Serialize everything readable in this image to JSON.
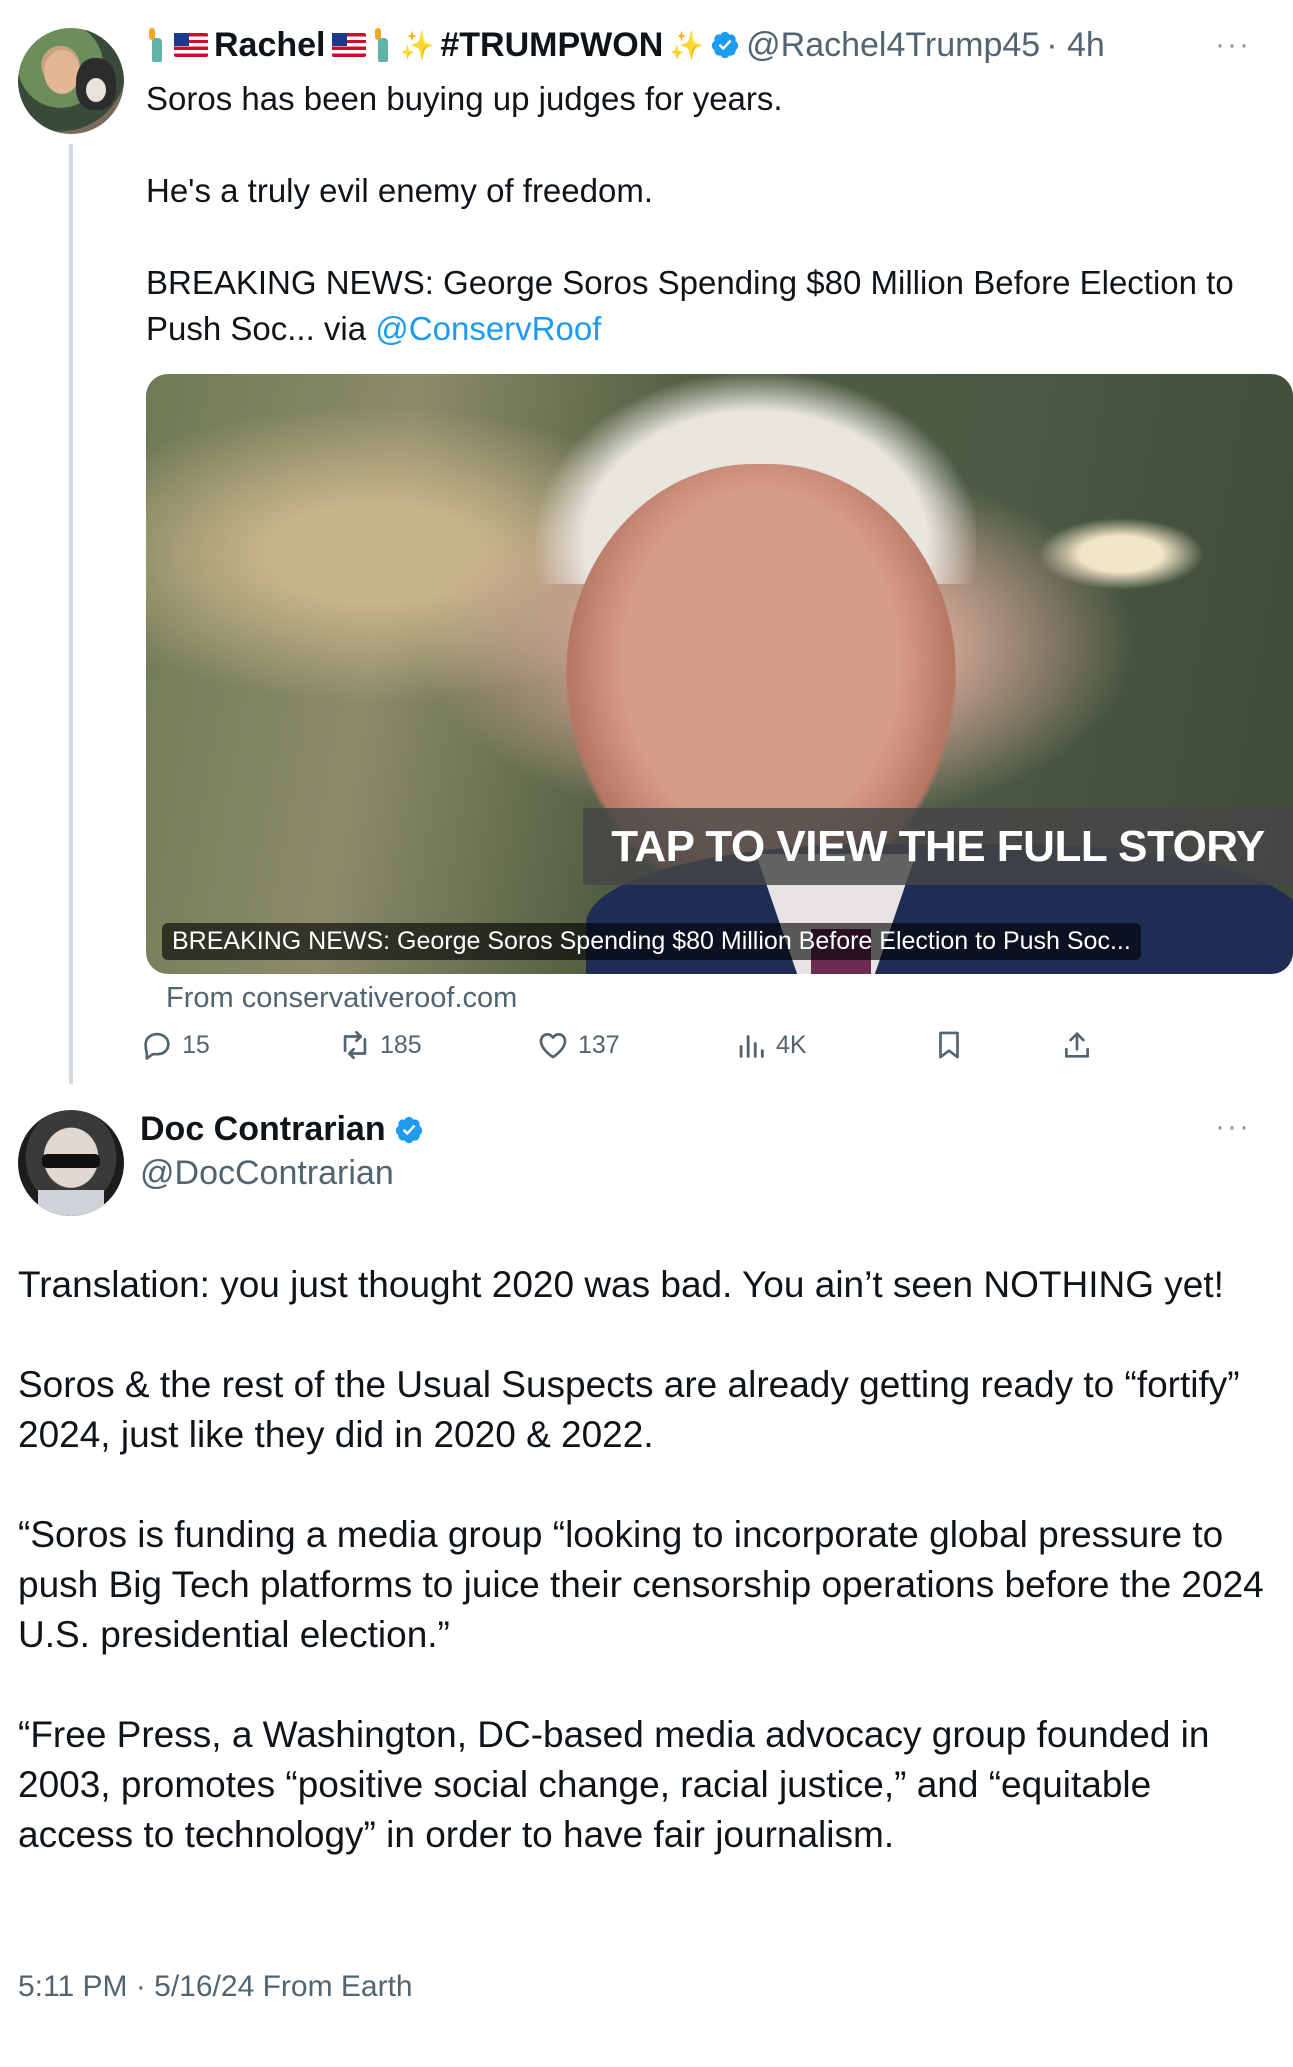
{
  "tweet1": {
    "display_name": "Rachel",
    "hashtag": "#TRUMPWON",
    "handle": "@Rachel4Trump45",
    "time": "· 4h",
    "more": "···",
    "text": {
      "line1": "Soros has been buying up judges for years.",
      "line2": "He's a truly evil enemy of freedom.",
      "line3": " BREAKING NEWS: George Soros Spending $80 Million Before Election to Push Soc... via ",
      "mention": "@ConservRoof"
    },
    "card": {
      "banner": "TAP TO VIEW THE FULL STORY",
      "caption": "BREAKING NEWS: George Soros Spending $80 Million Before Election to Push Soc...",
      "source": "From conservativeroof.com"
    },
    "actions": {
      "replies": "15",
      "reposts": "185",
      "likes": "137",
      "views": "4K"
    }
  },
  "tweet2": {
    "display_name": "Doc Contrarian",
    "handle": "@DocContrarian",
    "more": "···",
    "paragraphs": [
      "Translation:  you just thought 2020 was bad. You ain’t seen NOTHING yet!",
      "Soros & the rest of the Usual Suspects are already getting ready to “fortify” 2024, just like they did in 2020 & 2022.",
      "“Soros is funding a media group “looking to incorporate global pressure to push Big Tech platforms to juice their censorship operations before the 2024 U.S. presidential election.”",
      "“Free Press, a Washington, DC-based media advocacy group founded in 2003, promotes “positive social change, racial justice,” and “equitable access to technology” in order to have fair journalism."
    ],
    "timestamp": "5:11 PM · 5/16/24 From Earth"
  },
  "colors": {
    "accent": "#1d9bf0",
    "secondary_text": "#536471",
    "thread_line": "#cfd9de"
  },
  "icons": {
    "reply": "speech-bubble-icon",
    "repost": "repost-arrows-icon",
    "like": "heart-icon",
    "views": "bar-chart-icon",
    "bookmark": "bookmark-icon",
    "share": "share-upload-icon",
    "verified": "verified-badge-icon"
  }
}
